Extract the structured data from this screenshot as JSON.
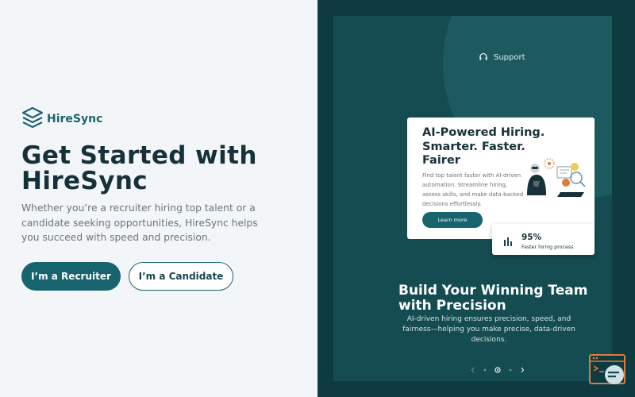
{
  "brand": {
    "name": "HireSync"
  },
  "hero": {
    "title": "Get Started with HireSync",
    "description": "Whether you’re a recruiter hiring top talent or a candidate seeking opportunities, HireSync helps you succeed with speed and precision."
  },
  "actions": {
    "recruiter_label": "I’m a Recruiter",
    "candidate_label": "I’m a Candidate"
  },
  "support": {
    "label": "Support",
    "icon": "headset-icon"
  },
  "card": {
    "title": "AI-Powered Hiring. Smarter. Faster. Fairer",
    "description": "Find top talent faster with AI-driven automation. Streamline hiring, assess skills, and make data-backed decisions effortlessly.",
    "button_label": "Learn more"
  },
  "stat": {
    "value": "95%",
    "label": "Faster hiring process",
    "icon": "bar-chart-icon"
  },
  "showcase": {
    "headline": "Build Your Winning Team with Precision",
    "subtext": "AI-driven hiring ensures precision, speed, and fairness—helping you make precise, data-driven decisions."
  },
  "colors": {
    "primary": "#17646f",
    "dark_bg": "#0d3b40",
    "panel_bg": "#144c52",
    "heading": "#17313a",
    "accent_orange": "#e07b3a"
  }
}
